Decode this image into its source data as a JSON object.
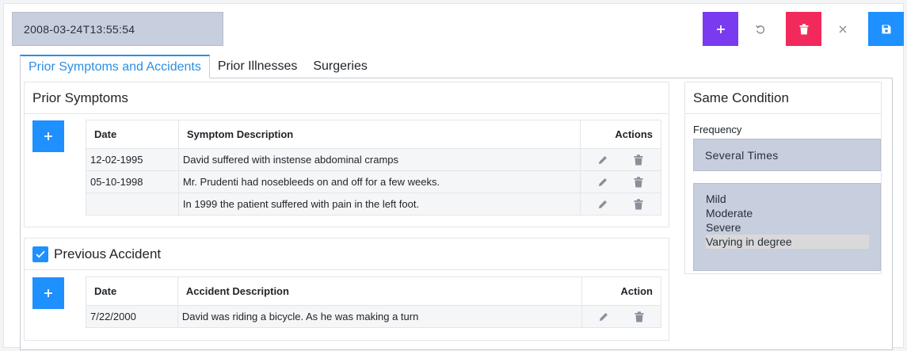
{
  "toolbar": {
    "datetime": "2008-03-24T13:55:54",
    "colors": {
      "add": "#7a3bf0",
      "delete": "#f2295b",
      "save": "#1e90ff"
    }
  },
  "tabs": [
    {
      "label": "Prior Symptoms and Accidents",
      "active": true
    },
    {
      "label": "Prior Illnesses",
      "active": false
    },
    {
      "label": "Surgeries",
      "active": false
    }
  ],
  "prior_symptoms": {
    "title": "Prior Symptoms",
    "columns": {
      "date": "Date",
      "description": "Symptom Description",
      "actions": "Actions"
    },
    "rows": [
      {
        "date": "12-02-1995",
        "description": "David suffered with instense abdominal cramps"
      },
      {
        "date": "05-10-1998",
        "description": "Mr. Prudenti had nosebleeds on and off for a few weeks."
      },
      {
        "date": "",
        "description": "In 1999 the patient suffered with pain in the left foot."
      }
    ]
  },
  "previous_accident": {
    "title": "Previous Accident",
    "checked": true,
    "columns": {
      "date": "Date",
      "description": "Accident Description",
      "action": "Action"
    },
    "rows": [
      {
        "date": "7/22/2000",
        "description": "David was riding a bicycle. As he was making a turn"
      }
    ]
  },
  "same_condition": {
    "title": "Same Condition",
    "frequency_label": "Frequency",
    "frequency_value": "Several Times",
    "severity_options": [
      "Mild",
      "Moderate",
      "Severe",
      "Varying in degree"
    ],
    "severity_selected": "Varying in degree"
  }
}
